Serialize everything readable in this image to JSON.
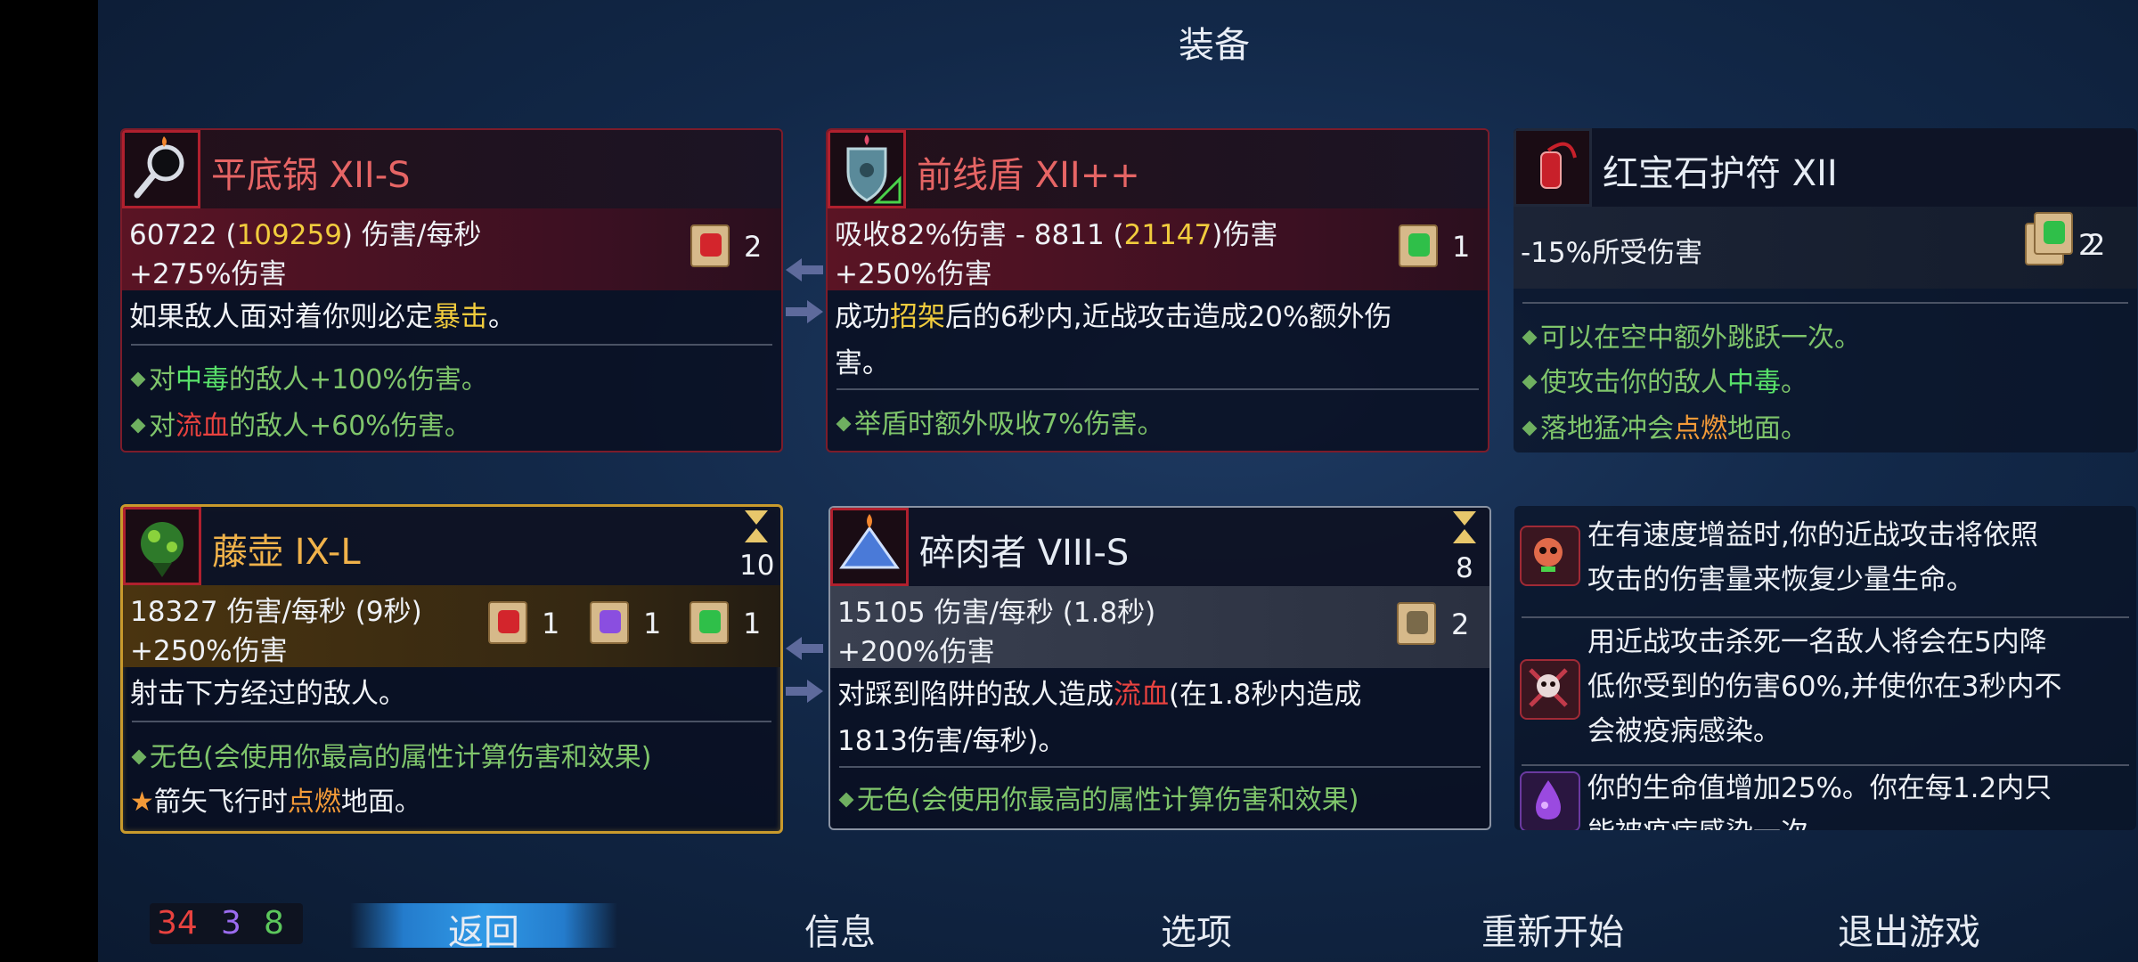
{
  "title": "装备",
  "cards": {
    "frying_pan": {
      "name": "平底锅",
      "tier": "XII-S",
      "dps": "60722",
      "dps_bonus": "109259",
      "dps_unit": "伤害/每秒",
      "bonus": "+275%伤害",
      "scroll_count": "2",
      "desc_pre": "如果敌人面对着你则必定",
      "desc_kw": "暴击",
      "desc_post": "。",
      "b1_pre": "对",
      "b1_kw": "中毒",
      "b1_post": "的敌人+100%伤害。",
      "b2_pre": "对",
      "b2_kw": "流血",
      "b2_post": "的敌人+60%伤害。"
    },
    "front_shield": {
      "name": "前线盾",
      "tier": "XII++",
      "stat_pre": "吸收82%伤害 - 8811 (",
      "stat_bonus": "21147",
      "stat_post": ")伤害",
      "bonus": "+250%伤害",
      "scroll_count": "1",
      "desc_pre": "成功",
      "desc_kw": "招架",
      "desc_post": "后的6秒内,近战攻击造成20%额外伤",
      "desc_line2": "害。",
      "b1": "举盾时额外吸收7%伤害。"
    },
    "ruby_amulet": {
      "name": "红宝石护符",
      "tier": "XII",
      "stat": "-15%所受伤害",
      "scroll_red_count": "2",
      "scroll_green_count": "2",
      "b1": "可以在空中额外跳跃一次。",
      "b2_pre": "使攻击你的敌人",
      "b2_kw": "中毒",
      "b2_post": "。",
      "b3_pre": "落地猛冲会",
      "b3_kw": "点燃",
      "b3_post": "地面。"
    },
    "vine_pot": {
      "name": "藤壶",
      "tier": "IX-L",
      "cooldown": "10",
      "stat": "18327 伤害/每秒 (9秒)",
      "bonus": "+250%伤害",
      "scroll_red_count": "1",
      "scroll_purple_count": "1",
      "scroll_green_count": "1",
      "desc": "射击下方经过的敌人。",
      "b1": "无色(会使用你最高的属性计算伤害和效果)",
      "b2_pre": "箭矢飞行时",
      "b2_kw": "点燃",
      "b2_post": "地面。"
    },
    "meat_grinder": {
      "name": "碎肉者",
      "tier": "VIII-S",
      "cooldown": "8",
      "stat": "15105 伤害/每秒 (1.8秒)",
      "bonus": "+200%伤害",
      "scroll_count": "2",
      "desc_pre": "对踩到陷阱的敌人造成",
      "desc_kw": "流血",
      "desc_post": "(在1.8秒内造成",
      "desc_line2": "1813伤害/每秒)。",
      "b1": "无色(会使用你最高的属性计算伤害和效果)"
    }
  },
  "mutations": [
    {
      "line1": "在有速度增益时,你的近战攻击将依照",
      "line2": "攻击的伤害量来恢复少量生命。",
      "icon": "skull-heal-icon"
    },
    {
      "line1": "用近战攻击杀死一名敌人将会在5内降",
      "line2": "低你受到的伤害60%,并使你在3秒内不",
      "line3": "会被疫病感染。",
      "icon": "skull-crossbones-icon"
    },
    {
      "line1": "你的生命值增加25%。你在每1.2内只",
      "line2": "能被疫病感染一次。",
      "icon": "purple-potion-icon"
    }
  ],
  "stats_cells": {
    "brutality": "34",
    "tactics": "3",
    "survival": "8"
  },
  "bottom_menu": {
    "back": "返回",
    "info": "信息",
    "options": "选项",
    "restart": "重新开始",
    "quit": "退出游戏"
  },
  "colors": {
    "brutality": "#e8423f",
    "tactics": "#9b6cf0",
    "survival": "#5cc75c",
    "accent": "#2e9ae6"
  }
}
